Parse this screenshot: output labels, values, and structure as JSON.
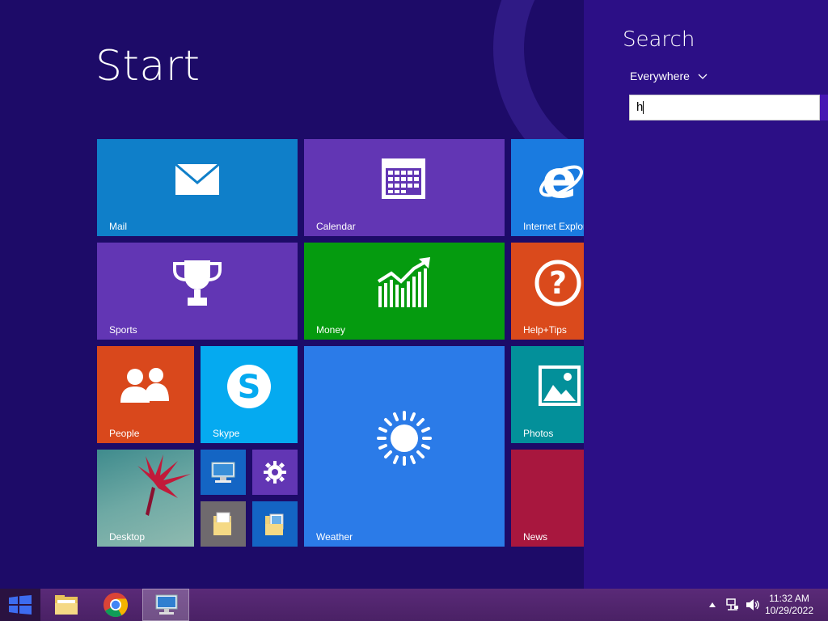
{
  "start": {
    "title": "Start"
  },
  "tiles": {
    "mail": "Mail",
    "calendar": "Calendar",
    "ie": "Internet Explorer",
    "sports": "Sports",
    "money": "Money",
    "help": "Help+Tips",
    "people": "People",
    "skype": "Skype",
    "weather": "Weather",
    "photos": "Photos",
    "desktop": "Desktop",
    "news": "News"
  },
  "search": {
    "title": "Search",
    "scope": "Everywhere",
    "query": "h"
  },
  "taskbar": {
    "time": "11:32 AM",
    "date": "10/29/2022"
  },
  "colors": {
    "background": "#1d0b68",
    "search_pane": "#2c0f86",
    "taskbar": "#4f2469"
  }
}
